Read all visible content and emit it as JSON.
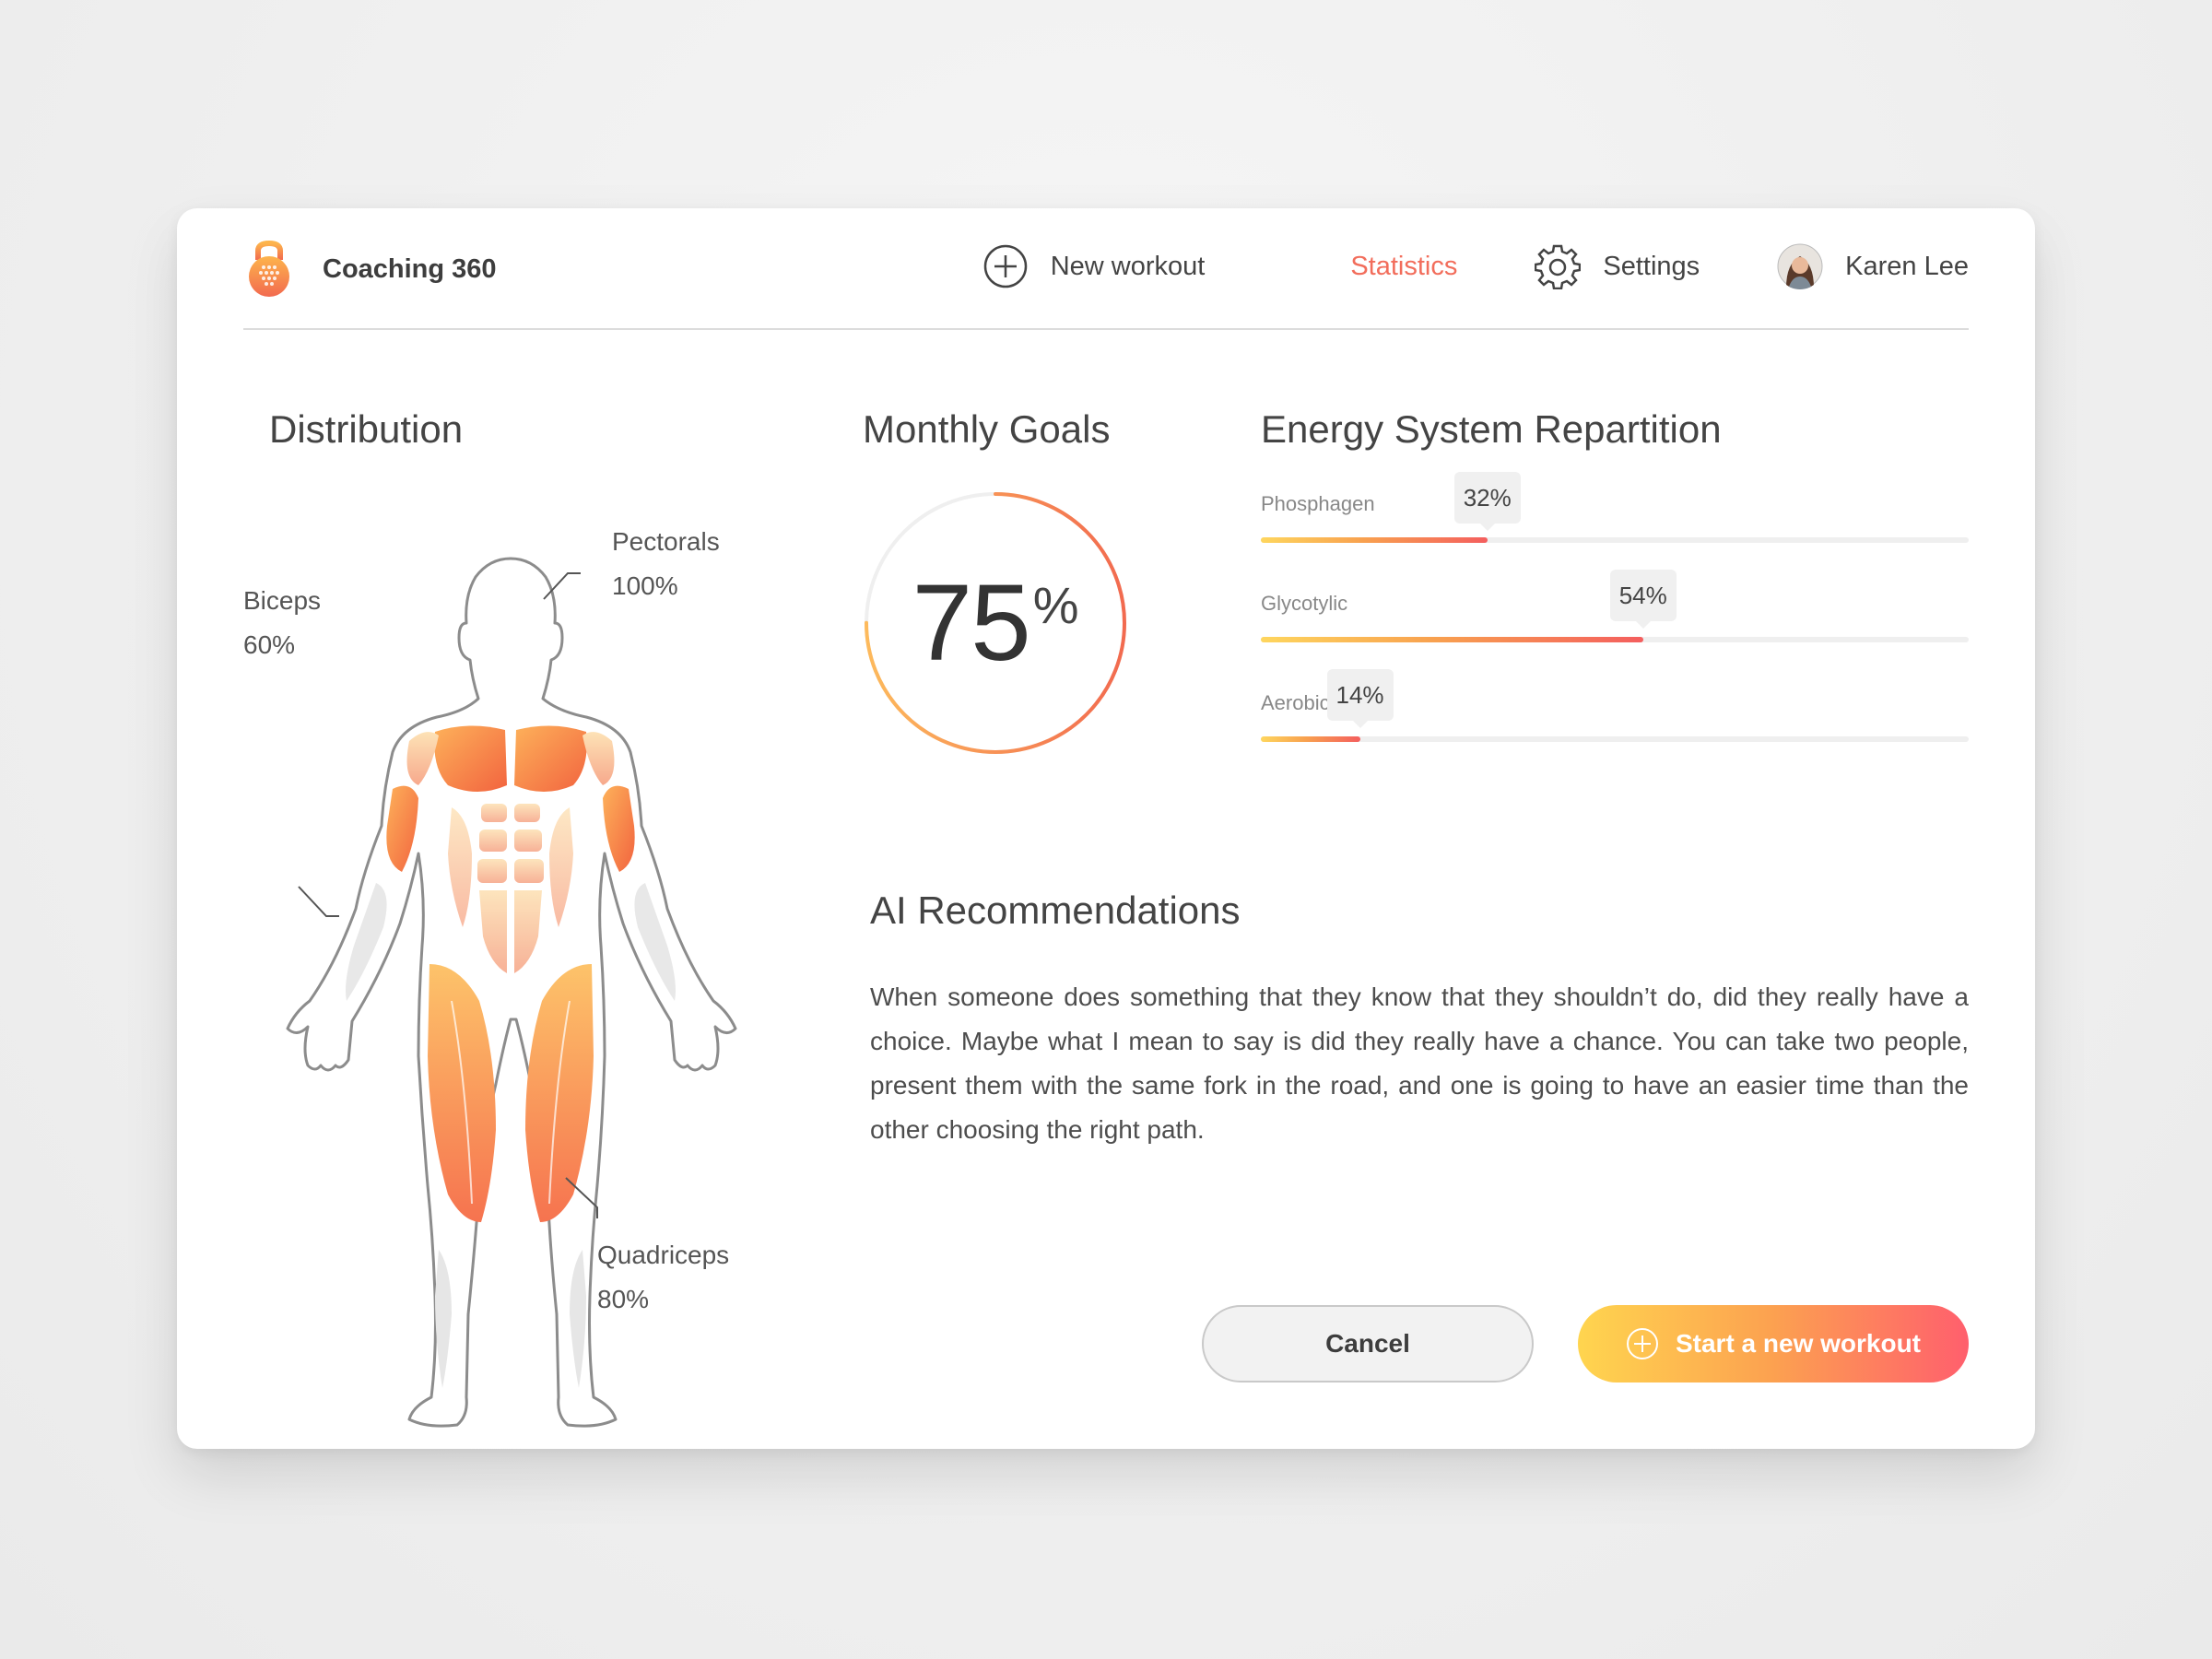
{
  "app": {
    "name": "Coaching 360",
    "brand_colors": [
      "#fed65e",
      "#f45e5e"
    ]
  },
  "nav": {
    "new_workout": {
      "label": "New workout",
      "icon": "plus-circle-icon"
    },
    "statistics": {
      "label": "Statistics",
      "icon": "bar-chart-icon",
      "active": true,
      "color": "#f26d5b"
    },
    "settings": {
      "label": "Settings",
      "icon": "gear-icon"
    },
    "user": {
      "label": "Karen Lee",
      "icon": "avatar"
    }
  },
  "distribution": {
    "title": "Distribution",
    "muscles": [
      {
        "name": "Pectorals",
        "value": "100%"
      },
      {
        "name": "Biceps",
        "value": "60%"
      },
      {
        "name": "Quadriceps",
        "value": "80%"
      }
    ]
  },
  "monthly_goals": {
    "title": "Monthly Goals",
    "value": "75",
    "unit": "%",
    "progress": 0.75
  },
  "energy": {
    "title": "Energy System Repartition",
    "systems": [
      {
        "label": "Phosphagen",
        "value": "32%",
        "fraction": 0.32
      },
      {
        "label": "Glycotylic",
        "value": "54%",
        "fraction": 0.54
      },
      {
        "label": "Aerobic",
        "value": "14%",
        "fraction": 0.14
      }
    ]
  },
  "ai": {
    "title": "AI Recommendations",
    "text": "When someone does something that they know that they shouldn’t do, did they really have a choice. Maybe what I mean to say is did they really have a chance. You can take two people, present them with the same fork in the road, and one is going to have an easier time than the other choosing the right path."
  },
  "actions": {
    "cancel": "Cancel",
    "start": "Start a new workout",
    "start_icon": "plus-circle-icon"
  }
}
